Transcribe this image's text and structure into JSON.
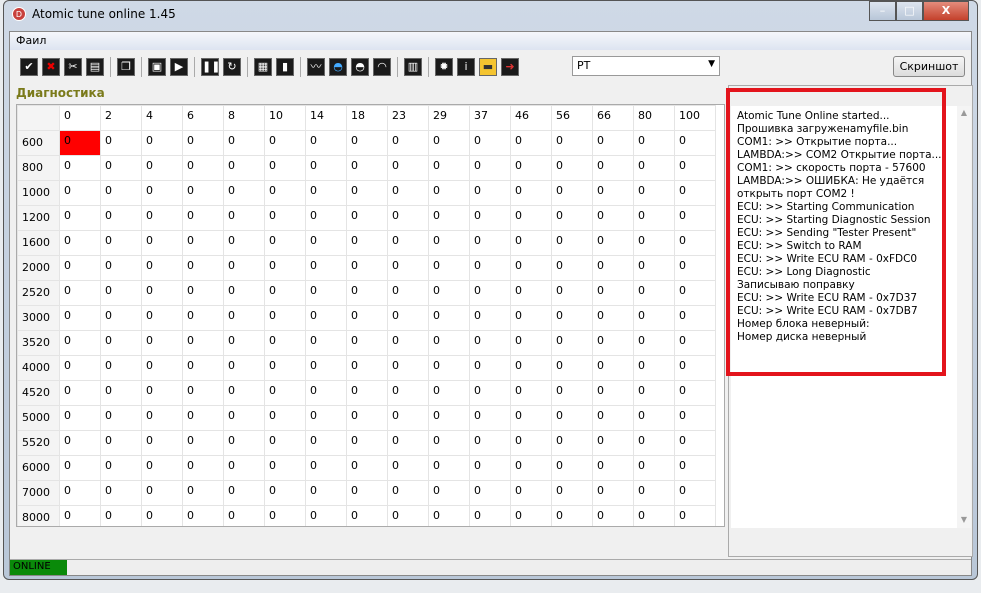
{
  "window": {
    "title": "Atomic tune online 1.45",
    "icon": "D"
  },
  "menu": {
    "file": "Фаил"
  },
  "toolbar": {
    "icons": [
      "check-icon",
      "cancel-icon",
      "tools-icon",
      "document-icon",
      "copy-icon",
      "chip-icon",
      "play-icon",
      "pause-icon",
      "refresh-icon",
      "table-icon",
      "bar-chart-icon",
      "monitor-icon",
      "car-blue-icon",
      "car-grey-icon",
      "gauge-icon",
      "lambda-icon",
      "settings-icon",
      "info-icon",
      "key-icon",
      "exit-icon"
    ],
    "combo_value": "PT",
    "screenshot_label": "Скриншот"
  },
  "section_title": "Диагностика",
  "grid": {
    "columns": [
      "0",
      "2",
      "4",
      "6",
      "8",
      "10",
      "14",
      "18",
      "23",
      "29",
      "37",
      "46",
      "56",
      "66",
      "80",
      "100"
    ],
    "rows": [
      "600",
      "800",
      "1000",
      "1200",
      "1600",
      "2000",
      "2520",
      "3000",
      "3520",
      "4000",
      "4520",
      "5000",
      "5520",
      "6000",
      "7000",
      "8000"
    ],
    "value": "0",
    "highlight": {
      "row": "600",
      "col": "0",
      "color": "#ff0000"
    }
  },
  "log": [
    "Atomic Tune Online started...",
    "Прошивка загруженаmyfile.bin",
    "COM1: >> Открытие порта...",
    "LAMBDA:>> COM2 Открытие порта...",
    "COM1: >> скорость порта - 57600",
    "LAMBDA:>> ОШИБКА: Не удаётся",
    "открыть порт COM2 !",
    "ECU: >> Starting Communication",
    "ECU: >> Starting Diagnostic Session",
    "ECU: >> Sending \"Tester Present\"",
    "ECU: >> Switch to RAM",
    "ECU: >> Write ECU RAM - 0xFDC0",
    "ECU: >> Long Diagnostic",
    "Записываю поправку",
    "ECU: >> Write ECU RAM - 0x7D37",
    "ECU: >> Write ECU RAM - 0x7DB7",
    "Номер блока неверный:",
    "Номер диска неверный"
  ],
  "status": {
    "connection": "ONLINE",
    "color": "#0a8a0a"
  }
}
